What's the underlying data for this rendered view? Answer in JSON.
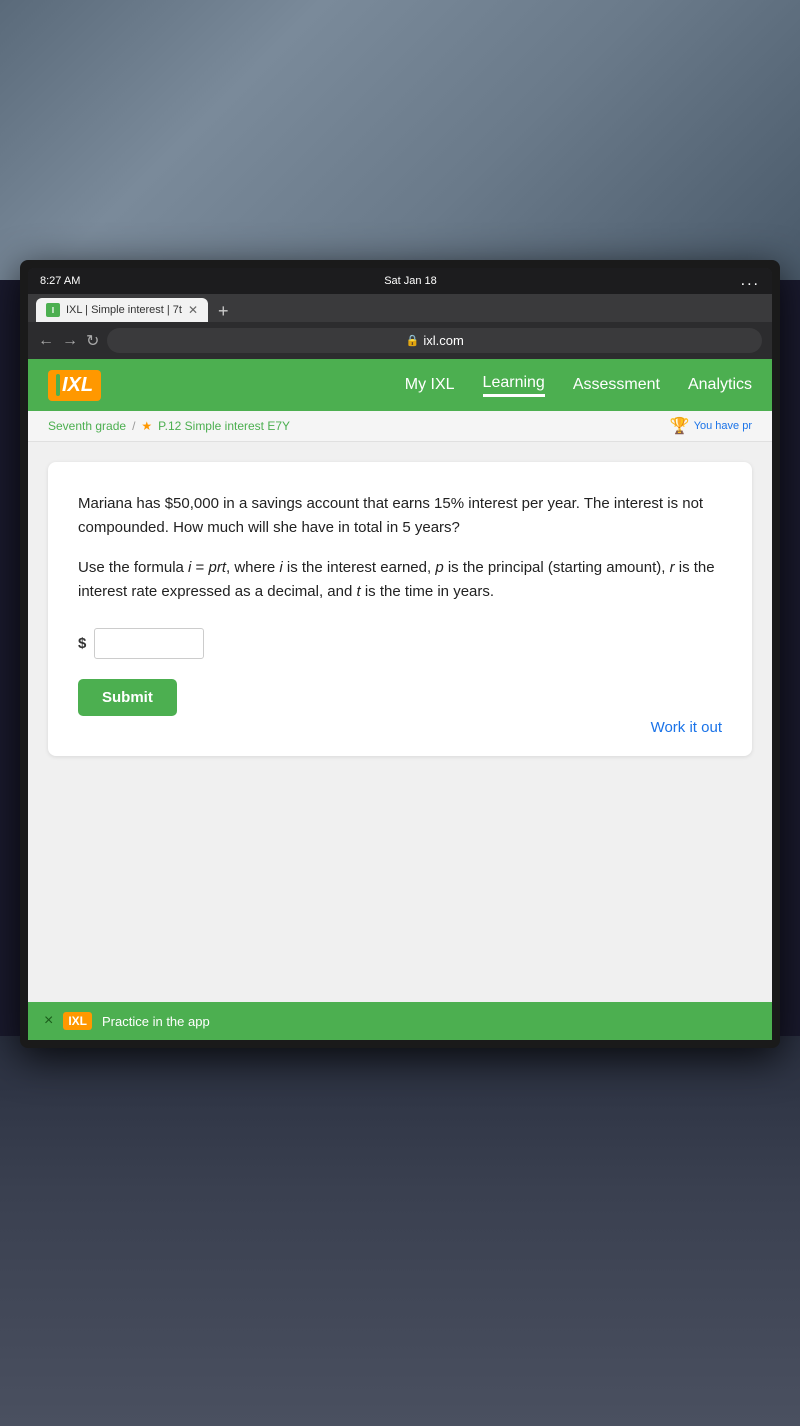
{
  "status_bar": {
    "time": "8:27 AM",
    "date": "Sat Jan 18",
    "menu_dots": "..."
  },
  "browser": {
    "tab_title": "IXL | Simple interest | 7t",
    "address": "ixl.com",
    "lock_symbol": "🔒"
  },
  "navbar": {
    "logo_text": "IXL",
    "nav_items": [
      {
        "label": "My IXL",
        "active": false
      },
      {
        "label": "Learning",
        "active": true
      },
      {
        "label": "Assessment",
        "active": false
      },
      {
        "label": "Analytics",
        "active": false
      }
    ]
  },
  "breadcrumb": {
    "grade": "Seventh grade",
    "skill_code": "P.12 Simple interest",
    "skill_id": "E7Y",
    "trophy_text": "You have pr"
  },
  "question": {
    "text": "Mariana has $50,000 in a savings account that earns 15% interest per year. The interest is not compounded. How much will she have in total in 5 years?",
    "formula_text": "Use the formula i = prt, where i is the interest earned, p is the principal (starting amount), r is the interest rate expressed as a decimal, and t is the time in years.",
    "input_prefix": "$",
    "input_placeholder": "",
    "submit_label": "Submit",
    "work_it_out_label": "Work it out"
  },
  "app_promo": {
    "close_symbol": "×",
    "logo_text": "IXL",
    "promo_text": "Practice in the app"
  }
}
